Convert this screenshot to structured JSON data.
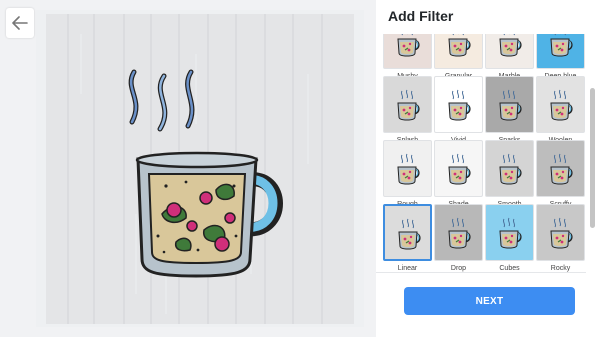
{
  "panel": {
    "title": "Add Filter",
    "next_label": "NEXT"
  },
  "filters": [
    {
      "label": "Mushy",
      "bg": "#e9ddd9",
      "selected": false
    },
    {
      "label": "Granular",
      "bg": "#f5ebe0",
      "selected": false
    },
    {
      "label": "Marble",
      "bg": "#f1ece8",
      "selected": false
    },
    {
      "label": "Deep blue",
      "bg": "#4fb3e6",
      "selected": false
    },
    {
      "label": "Splash",
      "bg": "#d9d9d9",
      "selected": false
    },
    {
      "label": "Vivid",
      "bg": "#ffffff",
      "selected": false
    },
    {
      "label": "Sparks",
      "bg": "#a9a9a9",
      "selected": false
    },
    {
      "label": "Woolen",
      "bg": "#e2e2e2",
      "selected": false
    },
    {
      "label": "Rough",
      "bg": "#f0f0f0",
      "selected": false
    },
    {
      "label": "Shade",
      "bg": "#f6f6f6",
      "selected": false
    },
    {
      "label": "Smooth",
      "bg": "#d4d4d4",
      "selected": false
    },
    {
      "label": "Scruffy",
      "bg": "#bdbdbd",
      "selected": false
    },
    {
      "label": "Linear",
      "bg": "#dcdcdc",
      "selected": true
    },
    {
      "label": "Drop",
      "bg": "#b8b8b8",
      "selected": false
    },
    {
      "label": "Cubes",
      "bg": "#8ad0ef",
      "selected": false
    },
    {
      "label": "Rocky",
      "bg": "#c8c8c8",
      "selected": false
    }
  ],
  "colors": {
    "accent": "#3d8df2",
    "mug_glass": "#b7c3cc",
    "tea": "#d9c79a",
    "handle": "#6ec0e6",
    "steam": "#6a90c8",
    "berry": "#d02f7a",
    "leaf": "#3f7a3a"
  }
}
